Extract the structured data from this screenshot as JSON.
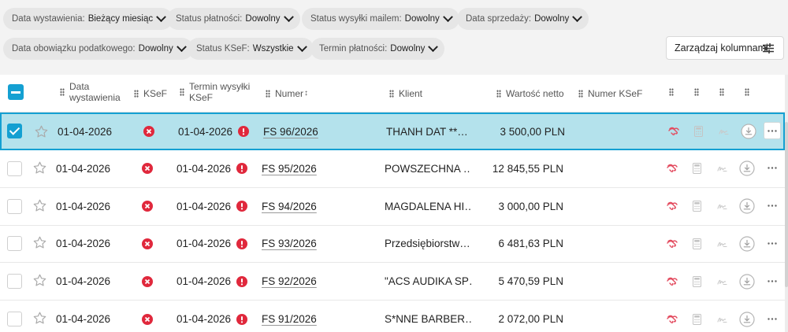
{
  "filters": [
    {
      "label": "Data wystawienia:",
      "value": "Bieżący miesiąc"
    },
    {
      "label": "Status płatności:",
      "value": "Dowolny"
    },
    {
      "label": "Status wysyłki mailem:",
      "value": "Dowolny"
    },
    {
      "label": "Data sprzedaży:",
      "value": "Dowolny"
    },
    {
      "label": "Data obowiązku podatkowego:",
      "value": "Dowolny"
    },
    {
      "label": "Status KSeF:",
      "value": "Wszystkie"
    },
    {
      "label": "Termin płatności:",
      "value": "Dowolny"
    }
  ],
  "manage_columns_label": "Zarządzaj kolumnami",
  "columns": {
    "issue_date": "Data wystawienia",
    "ksef": "KSeF",
    "send_deadline": "Termin wysyłki KSeF",
    "number": "Numer",
    "number_sort": "↕",
    "client": "Klient",
    "net_value": "Wartość netto",
    "ksef_number": "Numer KSeF"
  },
  "icons": {
    "ksef_status": "error-circle-icon",
    "send_status": "exclamation-circle-icon",
    "actions": [
      "handshake-icon",
      "calculator-icon",
      "signature-icon",
      "download-icon",
      "more-icon"
    ]
  },
  "colors": {
    "accent": "#14a0d2",
    "selected_row": "#b4e2ec",
    "error": "#e0283c"
  },
  "rows": [
    {
      "date": "01-04-2026",
      "deadline": "01-04-2026",
      "number": "FS 96/2026",
      "client": "THANH DAT **…",
      "net": "3 500,00 PLN",
      "selected": true
    },
    {
      "date": "01-04-2026",
      "deadline": "01-04-2026",
      "number": "FS 95/2026",
      "client": "POWSZECHNA …",
      "net": "12 845,55 PLN",
      "selected": false
    },
    {
      "date": "01-04-2026",
      "deadline": "01-04-2026",
      "number": "FS 94/2026",
      "client": "MAGDALENA HI…",
      "net": "3 000,00 PLN",
      "selected": false
    },
    {
      "date": "01-04-2026",
      "deadline": "01-04-2026",
      "number": "FS 93/2026",
      "client": "Przedsiębiorstw…",
      "net": "6 481,63 PLN",
      "selected": false
    },
    {
      "date": "01-04-2026",
      "deadline": "01-04-2026",
      "number": "FS 92/2026",
      "client": "\"ACS AUDIKA SP…",
      "net": "5 470,59 PLN",
      "selected": false
    },
    {
      "date": "01-04-2026",
      "deadline": "01-04-2026",
      "number": "FS 91/2026",
      "client": "S*NNE BARBER…",
      "net": "2 072,00 PLN",
      "selected": false
    }
  ]
}
